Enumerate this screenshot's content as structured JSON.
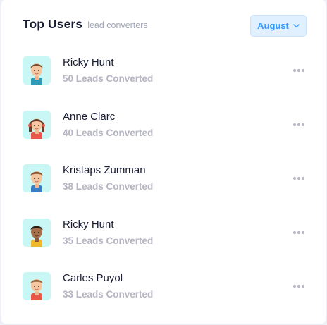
{
  "header": {
    "title": "Top Users",
    "subtitle": "lead converters",
    "month_button": "August"
  },
  "colors": {
    "accent": "#3699ff",
    "accent_bg": "#e1f0ff",
    "avatar_bg": "#c9f7f5",
    "muted_text": "#b5b5c3",
    "title_text": "#181c32"
  },
  "users": [
    {
      "name": "Ricky Hunt",
      "leads": "50 Leads Converted",
      "avatar": "boy-avatar-icon"
    },
    {
      "name": "Anne Clarc",
      "leads": "40 Leads Converted",
      "avatar": "girl-avatar-icon"
    },
    {
      "name": "Kristaps Zumman",
      "leads": "38 Leads Converted",
      "avatar": "boy-avatar-icon"
    },
    {
      "name": "Ricky Hunt",
      "leads": "35 Leads Converted",
      "avatar": "boy-dark-avatar-icon"
    },
    {
      "name": "Carles Puyol",
      "leads": "33 Leads Converted",
      "avatar": "boy-avatar-icon"
    }
  ]
}
